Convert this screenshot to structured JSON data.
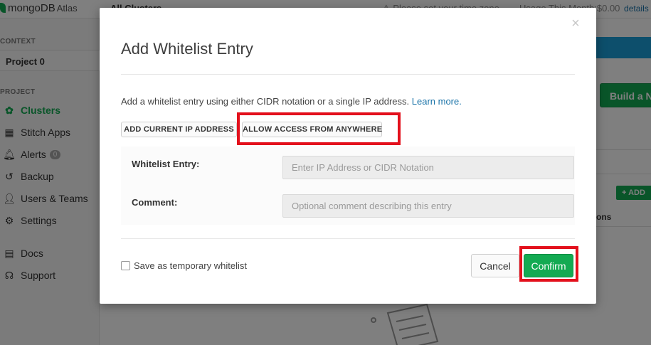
{
  "app": {
    "logo_text": "mongoDB",
    "logo_suffix": "Atlas",
    "breadcrumb": "All Clusters",
    "timezone_notice": "Please set your time zone",
    "usage_label": "Usage This Month:",
    "usage_value": "$0.00",
    "usage_link": "details"
  },
  "sidebar": {
    "context_label": "CONTEXT",
    "project_name": "Project 0",
    "project_label": "PROJECT",
    "items": [
      {
        "label": "Clusters",
        "icon": "leaf-icon"
      },
      {
        "label": "Stitch Apps",
        "icon": "stitch-icon"
      },
      {
        "label": "Alerts",
        "icon": "bell-icon",
        "badge": "0"
      },
      {
        "label": "Backup",
        "icon": "history-icon"
      },
      {
        "label": "Users & Teams",
        "icon": "user-icon"
      },
      {
        "label": "Settings",
        "icon": "gear-icon"
      },
      {
        "label": "Docs",
        "icon": "book-icon"
      },
      {
        "label": "Support",
        "icon": "headset-icon"
      }
    ]
  },
  "background": {
    "build_button": "Build a Ne",
    "add_button": "+ ADD",
    "column_fragment": "ons"
  },
  "modal": {
    "title": "Add Whitelist Entry",
    "description": "Add a whitelist entry using either CIDR notation or a single IP address.",
    "learn_more": "Learn more.",
    "add_current_ip": "ADD CURRENT IP ADDRESS",
    "allow_anywhere": "ALLOW ACCESS FROM ANYWHERE",
    "whitelist_label": "Whitelist Entry:",
    "whitelist_placeholder": "Enter IP Address or CIDR Notation",
    "comment_label": "Comment:",
    "comment_placeholder": "Optional comment describing this entry",
    "temporary_label": "Save as temporary whitelist",
    "temporary_checked": false,
    "cancel": "Cancel",
    "confirm": "Confirm",
    "close_icon": "×"
  },
  "colors": {
    "accent_green": "#13aa52",
    "highlight_red": "#e3101c",
    "link_blue": "#1a73a8"
  }
}
